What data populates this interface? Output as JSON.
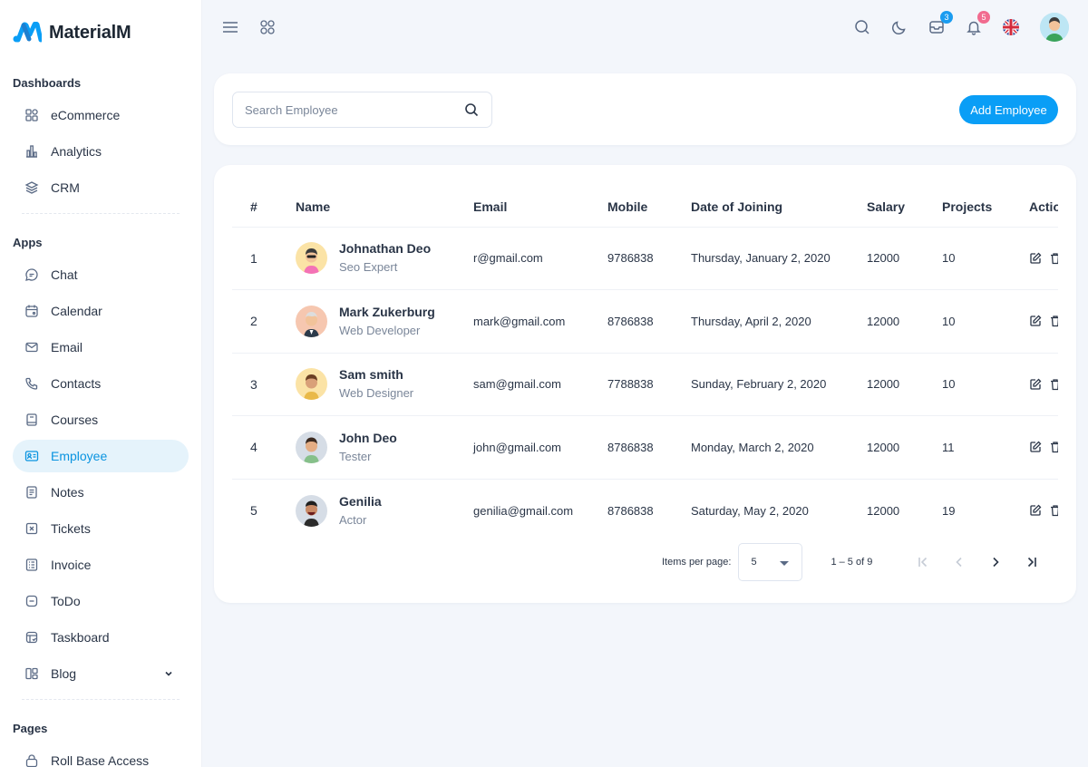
{
  "brand": {
    "name": "MaterialM"
  },
  "sidebar": {
    "sections": [
      {
        "title": "Dashboards",
        "items": [
          {
            "label": "eCommerce",
            "icon": "apps-icon"
          },
          {
            "label": "Analytics",
            "icon": "chart-icon"
          },
          {
            "label": "CRM",
            "icon": "layers-icon"
          }
        ]
      },
      {
        "title": "Apps",
        "items": [
          {
            "label": "Chat",
            "icon": "chat-icon"
          },
          {
            "label": "Calendar",
            "icon": "calendar-icon"
          },
          {
            "label": "Email",
            "icon": "mail-icon"
          },
          {
            "label": "Contacts",
            "icon": "phone-icon"
          },
          {
            "label": "Courses",
            "icon": "book-icon"
          },
          {
            "label": "Employee",
            "icon": "id-card-icon",
            "active": true
          },
          {
            "label": "Notes",
            "icon": "notes-icon"
          },
          {
            "label": "Tickets",
            "icon": "ticket-icon"
          },
          {
            "label": "Invoice",
            "icon": "invoice-icon"
          },
          {
            "label": "ToDo",
            "icon": "todo-icon"
          },
          {
            "label": "Taskboard",
            "icon": "taskboard-icon"
          },
          {
            "label": "Blog",
            "icon": "blog-icon",
            "expandable": true
          }
        ]
      },
      {
        "title": "Pages",
        "items": [
          {
            "label": "Roll Base Access",
            "icon": "lock-icon"
          }
        ]
      }
    ]
  },
  "topbar": {
    "messages_badge": "3",
    "notifications_badge": "5",
    "colors": {
      "messages_badge": "#1a9cf0",
      "notifications_badge": "#f16b8f"
    }
  },
  "search": {
    "placeholder": "Search Employee",
    "value": ""
  },
  "actions": {
    "add_label": "Add Employee"
  },
  "table": {
    "headers": {
      "idx": "#",
      "name": "Name",
      "email": "Email",
      "mobile": "Mobile",
      "doj": "Date of Joining",
      "salary": "Salary",
      "projects": "Projects",
      "action": "Actio"
    },
    "rows": [
      {
        "idx": "1",
        "name": "Johnathan Deo",
        "role": "Seo Expert",
        "email": "r@gmail.com",
        "mobile": "9786838",
        "doj": "Thursday, January 2, 2020",
        "salary": "12000",
        "projects": "10",
        "avatar_bg": "#fbe3a6"
      },
      {
        "idx": "2",
        "name": "Mark Zukerburg",
        "role": "Web Developer",
        "email": "mark@gmail.com",
        "mobile": "8786838",
        "doj": "Thursday, April 2, 2020",
        "salary": "12000",
        "projects": "10",
        "avatar_bg": "#f6c7b0"
      },
      {
        "idx": "3",
        "name": "Sam smith",
        "role": "Web Designer",
        "email": "sam@gmail.com",
        "mobile": "7788838",
        "doj": "Sunday, February 2, 2020",
        "salary": "12000",
        "projects": "10",
        "avatar_bg": "#fbe3a6"
      },
      {
        "idx": "4",
        "name": "John Deo",
        "role": "Tester",
        "email": "john@gmail.com",
        "mobile": "8786838",
        "doj": "Monday, March 2, 2020",
        "salary": "12000",
        "projects": "11",
        "avatar_bg": "#d6dde6"
      },
      {
        "idx": "5",
        "name": "Genilia",
        "role": "Actor",
        "email": "genilia@gmail.com",
        "mobile": "8786838",
        "doj": "Saturday, May 2, 2020",
        "salary": "12000",
        "projects": "19",
        "avatar_bg": "#d6dde6"
      }
    ]
  },
  "pagination": {
    "items_per_page_label": "Items per page:",
    "items_per_page": "5",
    "range": "1 – 5 of 9"
  },
  "colors": {
    "accent": "#0a9ef6",
    "active_bg": "#e5f3fb"
  }
}
